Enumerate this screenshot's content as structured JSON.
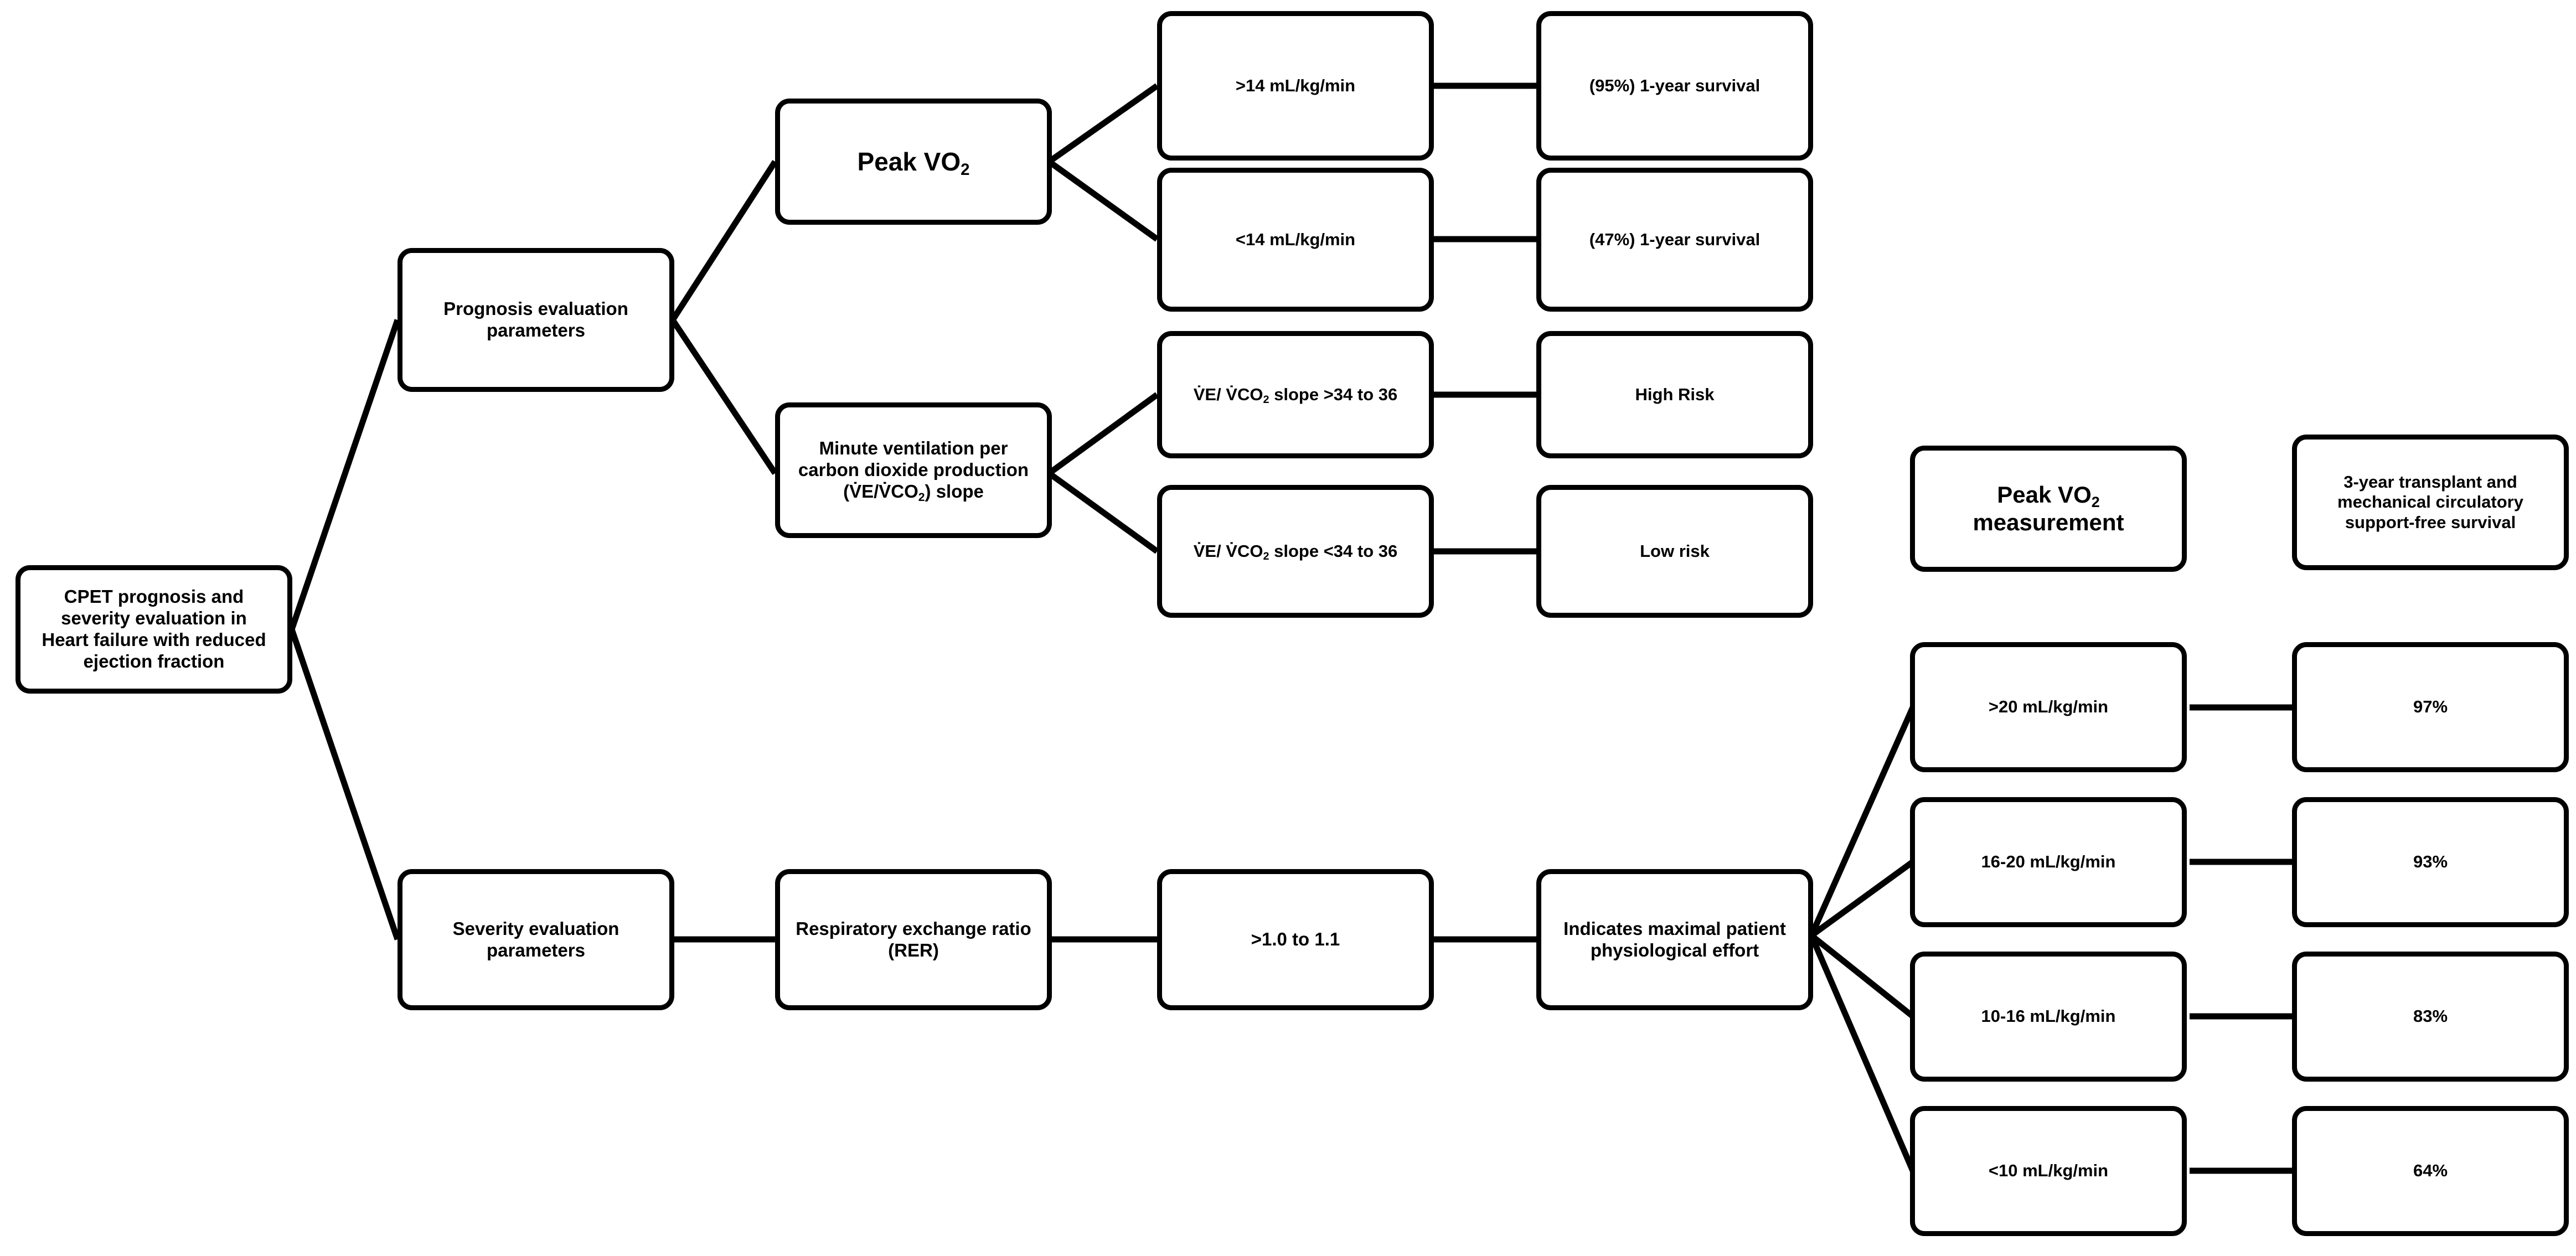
{
  "diagram": {
    "title": "CPET prognosis and severity evaluation flowchart",
    "line_color": "#000000",
    "box_fill": "#ffffff",
    "text_color": "#000000"
  },
  "root": {
    "label": "CPET prognosis and\nseverity evaluation in\nHeart failure with reduced\nejection fraction"
  },
  "branches": {
    "prognosis": {
      "label": "Prognosis evaluation\nparameters"
    },
    "severity": {
      "label": "Severity evaluation\nparameters"
    }
  },
  "prognosis_params": {
    "peak_vo2": {
      "label_pre": "Peak VO",
      "label_sub": "2",
      "label_post": ""
    },
    "minute_ventilation": {
      "line1": "Minute ventilation per",
      "line2": "carbon dioxide production",
      "line3_pre": "(V̇E/V̇CO",
      "line3_sub": "2",
      "line3_post": ") slope"
    }
  },
  "peak_vo2_criteria": [
    {
      "criterion": ">14 mL/kg/min",
      "outcome": "(95%) 1-year survival"
    },
    {
      "criterion": "<14 mL/kg/min",
      "outcome": "(47%) 1-year survival"
    }
  ],
  "ve_vco2_criteria": [
    {
      "criterion_pre": "V̇E/ V̇CO",
      "criterion_sub": "2",
      "criterion_post": " slope >34 to 36",
      "outcome": "High Risk"
    },
    {
      "criterion_pre": "V̇E/ V̇CO",
      "criterion_sub": "2",
      "criterion_post": " slope <34 to 36",
      "outcome": "Low risk"
    }
  ],
  "severity_chain": {
    "rer": {
      "label": "Respiratory exchange ratio\n(RER)"
    },
    "rer_value": {
      "label": ">1.0 to 1.1"
    },
    "interpretation": {
      "label": "Indicates maximal patient\nphysiological effort"
    }
  },
  "right_section": {
    "header_measurement": {
      "label_pre": "Peak VO",
      "label_sub": "2",
      "label_post": "\nmeasurement"
    },
    "header_outcome": {
      "label": "3-year transplant and\nmechanical circulatory\nsupport-free survival"
    },
    "rows": [
      {
        "measurement": ">20 mL/kg/min",
        "survival": "97%"
      },
      {
        "measurement": "16-20 mL/kg/min",
        "survival": "93%"
      },
      {
        "measurement": "10-16 mL/kg/min",
        "survival": "83%"
      },
      {
        "measurement": "<10 mL/kg/min",
        "survival": "64%"
      }
    ]
  }
}
